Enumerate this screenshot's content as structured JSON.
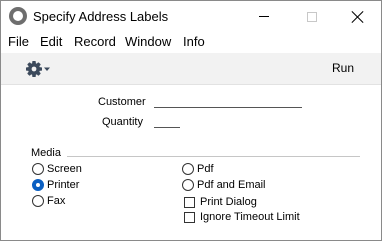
{
  "window": {
    "title": "Specify Address Labels"
  },
  "menu": [
    "File",
    "Edit",
    "Record",
    "Window",
    "Info"
  ],
  "toolbar": {
    "run_label": "Run"
  },
  "form": {
    "customer_label": "Customer",
    "customer_value": "",
    "quantity_label": "Quantity",
    "quantity_value": ""
  },
  "media": {
    "label": "Media",
    "options": {
      "screen": {
        "label": "Screen",
        "selected": false
      },
      "printer": {
        "label": "Printer",
        "selected": true
      },
      "fax": {
        "label": "Fax",
        "selected": false
      },
      "pdf": {
        "label": "Pdf",
        "selected": false
      },
      "pdf_email": {
        "label": "Pdf and Email",
        "selected": false
      }
    },
    "checkboxes": {
      "print_dialog": {
        "label": "Print Dialog",
        "checked": false
      },
      "ignore_timeout": {
        "label": "Ignore Timeout Limit",
        "checked": false
      }
    }
  },
  "colors": {
    "accent": "#0a5fc2",
    "toolbar_bg": "#f2f2f2"
  },
  "icons": {
    "app": "app-circle-icon",
    "settings": "gear-icon",
    "dropdown": "caret-down-icon"
  }
}
